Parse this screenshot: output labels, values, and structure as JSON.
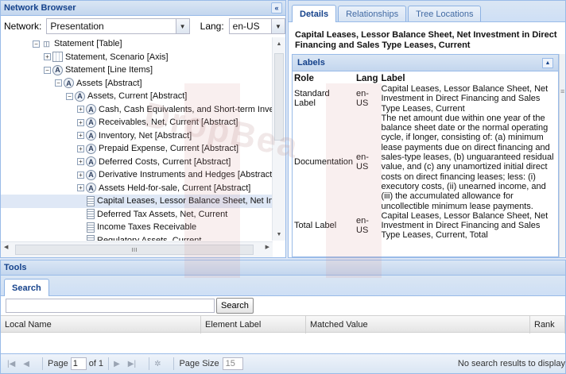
{
  "network_browser": {
    "title": "Network Browser",
    "network_label": "Network:",
    "network_value": "Presentation",
    "lang_label": "Lang:",
    "lang_value": "en-US",
    "tree": [
      {
        "label": "Statement [Table]",
        "icon": "folder-icon",
        "toggle": "−",
        "selected": false
      },
      {
        "label": "Statement, Scenario [Axis]",
        "icon": "axis-icon",
        "toggle": "+",
        "selected": false
      },
      {
        "label": "Statement [Line Items]",
        "icon": "abstract-icon",
        "toggle": "−",
        "selected": false
      },
      {
        "label": "Assets [Abstract]",
        "icon": "abstract-icon",
        "toggle": "−",
        "selected": false
      },
      {
        "label": "Assets, Current [Abstract]",
        "icon": "abstract-icon",
        "toggle": "−",
        "selected": false
      },
      {
        "label": "Cash, Cash Equivalents, and Short-term Investment",
        "icon": "abstract-icon",
        "toggle": "+",
        "selected": false
      },
      {
        "label": "Receivables, Net, Current [Abstract]",
        "icon": "abstract-icon",
        "toggle": "+",
        "selected": false
      },
      {
        "label": "Inventory, Net [Abstract]",
        "icon": "abstract-icon",
        "toggle": "+",
        "selected": false
      },
      {
        "label": "Prepaid Expense, Current [Abstract]",
        "icon": "abstract-icon",
        "toggle": "+",
        "selected": false
      },
      {
        "label": "Deferred Costs, Current [Abstract]",
        "icon": "abstract-icon",
        "toggle": "+",
        "selected": false
      },
      {
        "label": "Derivative Instruments and Hedges [Abstract]",
        "icon": "abstract-icon",
        "toggle": "+",
        "selected": false
      },
      {
        "label": "Assets Held-for-sale, Current [Abstract]",
        "icon": "abstract-icon",
        "toggle": "+",
        "selected": false
      },
      {
        "label": "Capital Leases, Lessor Balance Sheet, Net Investme",
        "icon": "concept-icon",
        "toggle": "",
        "selected": true
      },
      {
        "label": "Deferred Tax Assets, Net, Current",
        "icon": "concept-icon",
        "toggle": "",
        "selected": false
      },
      {
        "label": "Income Taxes Receivable",
        "icon": "concept-icon",
        "toggle": "",
        "selected": false
      },
      {
        "label": "Regulatory Assets, Current",
        "icon": "concept-icon",
        "toggle": "",
        "selected": false
      }
    ]
  },
  "details": {
    "tabs": [
      "Details",
      "Relationships",
      "Tree Locations"
    ],
    "active_tab": "Details",
    "concept_title": "Capital Leases, Lessor Balance Sheet, Net Investment in Direct Financing and Sales Type Leases, Current",
    "labels_panel_title": "Labels",
    "columns": {
      "role": "Role",
      "lang": "Lang",
      "label": "Label"
    },
    "rows": [
      {
        "role": "Standard Label",
        "lang": "en-US",
        "label": "Capital Leases, Lessor Balance Sheet, Net Investment in Direct Financing and Sales Type Leases, Current"
      },
      {
        "role": "Documentation",
        "lang": "en-US",
        "label": "The net amount due within one year of the balance sheet date or the normal operating cycle, if longer, consisting of: (a) minimum lease payments due on direct financing and sales-type leases, (b) unguaranteed residual value, and (c) any unamortized initial direct costs on direct financing leases; less: (i) executory costs, (ii) unearned income, and (iii) the accumulated allowance for uncollectible minimum lease payments."
      },
      {
        "role": "Total Label",
        "lang": "en-US",
        "label": "Capital Leases, Lessor Balance Sheet, Net Investment in Direct Financing and Sales Type Leases, Current, Total"
      }
    ]
  },
  "tools": {
    "title": "Tools",
    "tab": "Search",
    "search_value": "",
    "search_button": "Search",
    "columns": [
      "Local Name",
      "Element Label",
      "Matched Value",
      "Rank"
    ],
    "paging": {
      "page_label": "Page",
      "page_value": "1",
      "of_label": "of 1",
      "page_size_label": "Page Size",
      "page_size_value": "15",
      "status": "No search results to display"
    }
  },
  "watermark": "DropBea",
  "colors": {
    "header_text": "#15428b",
    "border": "#99bbe8",
    "selected_row": "#dfe8f6"
  }
}
